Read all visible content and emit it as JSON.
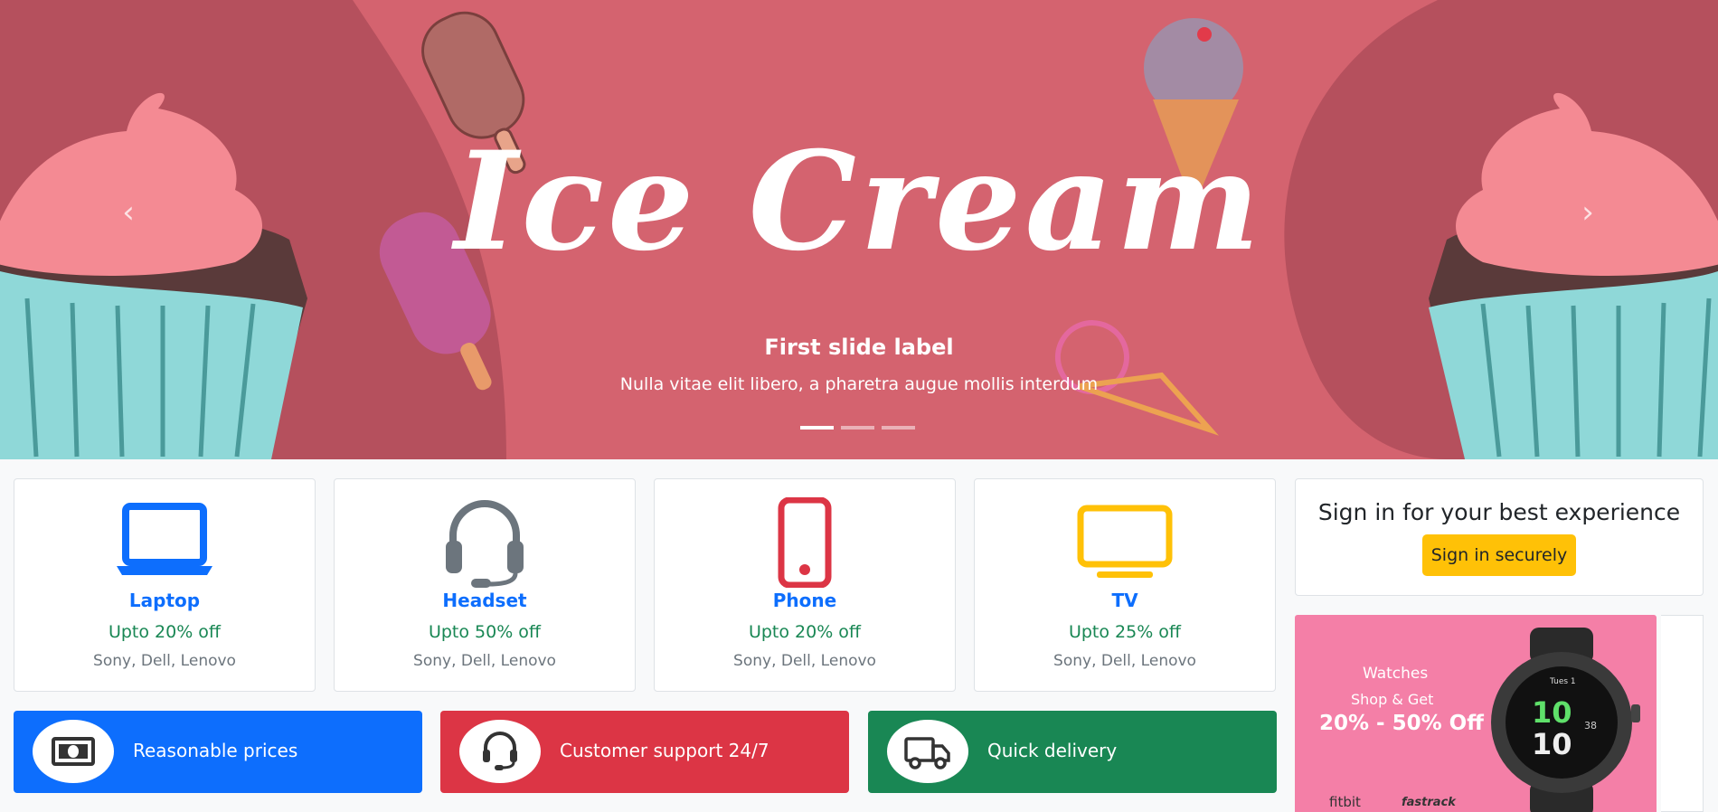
{
  "carousel": {
    "hero_text": "Ice Cream",
    "caption_title": "First slide label",
    "caption_text": "Nulla vitae elit libero, a pharetra augue mollis interdum",
    "prev_symbol": "‹",
    "next_symbol": "›",
    "slide_count": 3,
    "active_slide": 1
  },
  "categories": [
    {
      "name": "Laptop",
      "deal": "Upto 20% off",
      "brands": "Sony, Dell, Lenovo",
      "icon": "laptop-icon",
      "color": "#0d6efd"
    },
    {
      "name": "Headset",
      "deal": "Upto 50% off",
      "brands": "Sony, Dell, Lenovo",
      "icon": "headset-icon",
      "color": "#6c757d"
    },
    {
      "name": "Phone",
      "deal": "Upto 20% off",
      "brands": "Sony, Dell, Lenovo",
      "icon": "phone-icon",
      "color": "#dc3545"
    },
    {
      "name": "TV",
      "deal": "Upto 25% off",
      "brands": "Sony, Dell, Lenovo",
      "icon": "tv-icon",
      "color": "#ffc107"
    }
  ],
  "signin": {
    "title": "Sign in for your best experience",
    "button": "Sign in securely"
  },
  "promo": {
    "line1": "Watches",
    "line2": "Shop & Get",
    "line3": "20% - 50% Off",
    "brand1": "fitbit",
    "brand2": "fastrack",
    "watch_time_1": "10",
    "watch_time_2": "10",
    "watch_small": "38",
    "watch_day": "Tues 1"
  },
  "features": [
    {
      "label": "Reasonable prices",
      "icon": "money-icon",
      "color": "#0d6efd"
    },
    {
      "label": "Customer support 24/7",
      "icon": "headset-icon",
      "color": "#dc3545"
    },
    {
      "label": "Quick delivery",
      "icon": "truck-icon",
      "color": "#198754"
    }
  ]
}
